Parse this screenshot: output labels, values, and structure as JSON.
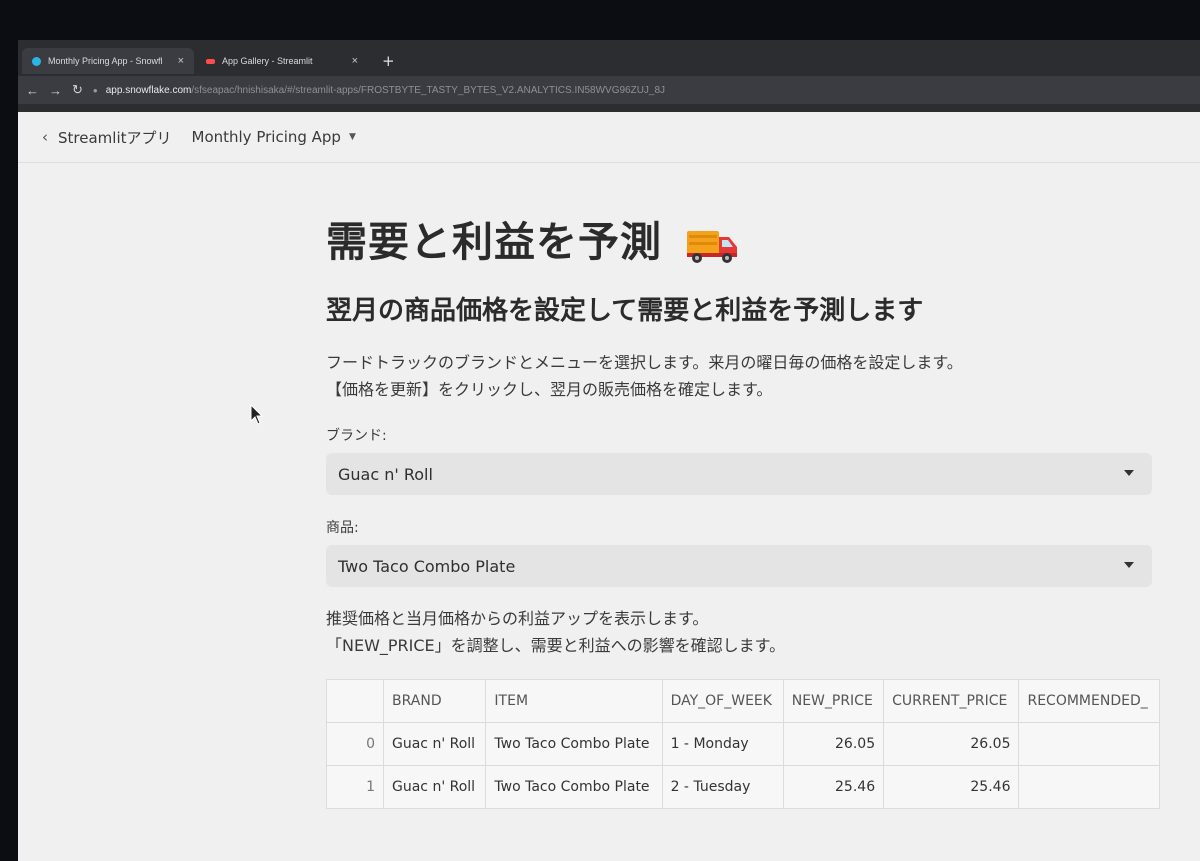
{
  "browser": {
    "tabs": [
      {
        "title": "Monthly Pricing App - Snowfl",
        "close": "×",
        "favicon_color": "#29b5e8"
      },
      {
        "title": "App Gallery - Streamlit",
        "close": "×",
        "favicon_color": "#ff4b4b"
      }
    ],
    "new_tab": "+",
    "url_host": "app.snowflake.com",
    "url_path": "/sfseapac/hnishisaka/#/streamlit-apps/FROSTBYTE_TASTY_BYTES_V2.ANALYTICS.IN58WVG96ZUJ_8J"
  },
  "appbar": {
    "back_label": "Streamlitアプリ",
    "app_name": "Monthly Pricing App"
  },
  "page": {
    "title": "需要と利益を予測",
    "title_icon": "truck-icon",
    "subtitle": "翌月の商品価格を設定して需要と利益を予測します",
    "desc_line1": "フードトラックのブランドとメニューを選択します。来月の曜日毎の価格を設定します。",
    "desc_line2": "【価格を更新】をクリックし、翌月の販売価格を確定します。",
    "brand_label": "ブランド:",
    "brand_value": "Guac n' Roll",
    "item_label": "商品:",
    "item_value": "Two Taco Combo Plate",
    "note_line1": "推奨価格と当月価格からの利益アップを表示します。",
    "note_line2": "「NEW_PRICE」を調整し、需要と利益への影響を確認します。"
  },
  "table": {
    "columns": [
      "",
      "BRAND",
      "ITEM",
      "DAY_OF_WEEK",
      "NEW_PRICE",
      "CURRENT_PRICE",
      "RECOMMENDED_"
    ],
    "rows": [
      {
        "idx": "0",
        "brand": "Guac n' Roll",
        "item": "Two Taco Combo Plate",
        "day": "1 - Monday",
        "new_price": "26.05",
        "current_price": "26.05",
        "recommended": ""
      },
      {
        "idx": "1",
        "brand": "Guac n' Roll",
        "item": "Two Taco Combo Plate",
        "day": "2 - Tuesday",
        "new_price": "25.46",
        "current_price": "25.46",
        "recommended": ""
      }
    ]
  },
  "colors": {
    "page_bg": "#f0f0f0",
    "select_bg": "#e4e4e4",
    "chrome_bg": "#2b2d31"
  }
}
